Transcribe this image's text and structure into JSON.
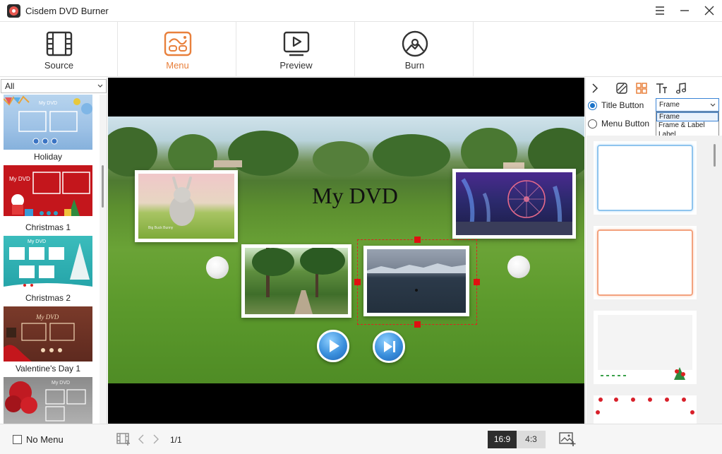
{
  "app": {
    "title": "Cisdem DVD Burner"
  },
  "toolbar": {
    "tabs": [
      {
        "label": "Source",
        "icon": "film-icon"
      },
      {
        "label": "Menu",
        "icon": "menu-template-icon"
      },
      {
        "label": "Preview",
        "icon": "play-screen-icon"
      },
      {
        "label": "Burn",
        "icon": "disc-icon"
      }
    ],
    "active_tab": "Menu"
  },
  "left_panel": {
    "filter": "All",
    "templates": [
      {
        "label": "Holiday"
      },
      {
        "label": "Christmas 1"
      },
      {
        "label": "Christmas 2"
      },
      {
        "label": "Valentine's Day 1"
      },
      {
        "label": ""
      }
    ]
  },
  "preview": {
    "menu_title": "My DVD",
    "colors": {
      "selection": "#e02020",
      "play_button": "#3a8fdc"
    }
  },
  "right_panel": {
    "radio_title": "Title Button",
    "radio_menu": "Menu Button",
    "selected_radio": "Title Button",
    "style_select": "Frame",
    "dropdown_options": [
      "Frame",
      "Frame & Label",
      "Label"
    ]
  },
  "bottom": {
    "no_menu_label": "No Menu",
    "page_indicator": "1/1",
    "ratio_16_9": "16:9",
    "ratio_4_3": "4:3",
    "active_ratio": "16:9"
  },
  "colors": {
    "accent": "#e8803c",
    "selected_blue": "#1a73c9"
  }
}
